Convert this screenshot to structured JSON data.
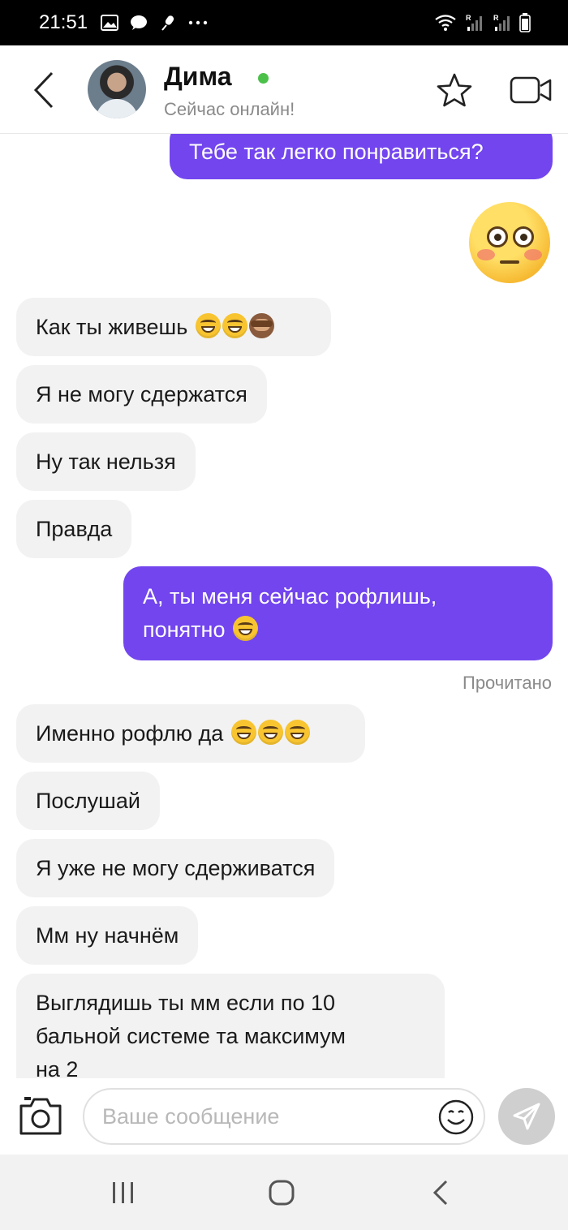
{
  "status_bar": {
    "time": "21:51",
    "icons_left": [
      "image-icon",
      "chat-bubble-icon",
      "microphone-icon",
      "more-icon"
    ],
    "icons_right": [
      "wifi-icon",
      "signal-icon",
      "signal-icon",
      "battery-icon"
    ]
  },
  "header": {
    "name": "Дима",
    "status": "Сейчас онлайн!",
    "online_color": "#4cc14a"
  },
  "messages": [
    {
      "dir": "out",
      "text": "Тебе так легко понравиться?"
    },
    {
      "dir": "out",
      "emoji": "flushed-face"
    },
    {
      "dir": "in",
      "text": "Как ты живешь",
      "emojis": [
        "grinning",
        "grinning",
        "see-no-evil-monkey"
      ]
    },
    {
      "dir": "in",
      "text": "Я не могу сдержатся"
    },
    {
      "dir": "in",
      "text": "Ну так нельзя"
    },
    {
      "dir": "in",
      "text": "Правда"
    },
    {
      "dir": "out",
      "text_line1": "А, ты меня сейчас рофлишь,",
      "text_line2": "понятно",
      "emojis": [
        "grinning"
      ]
    },
    {
      "dir": "in",
      "text": "Именно рофлю да",
      "emojis": [
        "grinning",
        "grinning",
        "grinning"
      ]
    },
    {
      "dir": "in",
      "text": "Послушай"
    },
    {
      "dir": "in",
      "text": "Я уже не могу сдерживатся"
    },
    {
      "dir": "in",
      "text": "Мм ну начнём"
    },
    {
      "dir": "in",
      "text_line1": "Выглядишь ты мм если по 10",
      "text_line2": "бальной системе та максимум",
      "text_line3": "на 2"
    }
  ],
  "read_status": "Прочитано",
  "input": {
    "placeholder": "Ваше сообщение",
    "value": ""
  },
  "colors": {
    "accent": "#7245ee",
    "incoming_bubble": "#f2f2f2"
  }
}
